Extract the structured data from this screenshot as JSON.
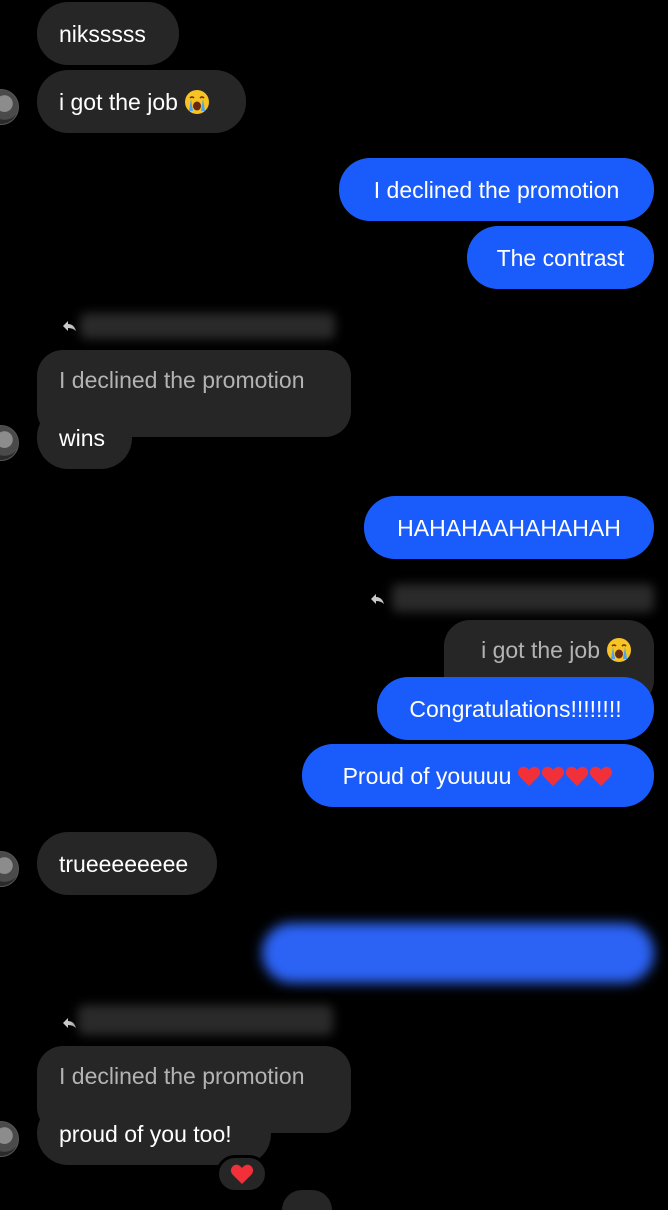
{
  "colors": {
    "background": "#000000",
    "incoming_bubble": "#262626",
    "outgoing_bubble": "#1a5cfb",
    "quoted_text": "#b3b3b3",
    "text": "#ffffff"
  },
  "messages": [
    {
      "direction": "incoming",
      "text": "niksssss"
    },
    {
      "direction": "incoming",
      "text": "i got the job",
      "emoji": "loudly-crying-face"
    },
    {
      "direction": "outgoing",
      "text": "I declined the promotion"
    },
    {
      "direction": "outgoing",
      "text": "The contrast"
    },
    {
      "direction": "incoming",
      "quoted": "I declined the promotion",
      "text": "wins"
    },
    {
      "direction": "outgoing",
      "text": "HAHAHAAHAHAHAH"
    },
    {
      "direction": "outgoing",
      "quoted": "i got the job",
      "quoted_emoji": "loudly-crying-face",
      "text": "Congratulations!!!!!!!!"
    },
    {
      "direction": "outgoing",
      "text": "Proud of youuuu",
      "emoji": "red-heart x4"
    },
    {
      "direction": "incoming",
      "text": "trueeeeeeee"
    },
    {
      "direction": "outgoing",
      "text": "",
      "redacted": true
    },
    {
      "direction": "incoming",
      "quoted": "I declined the promotion",
      "text": "proud of you too!",
      "reaction": "red-heart"
    }
  ]
}
